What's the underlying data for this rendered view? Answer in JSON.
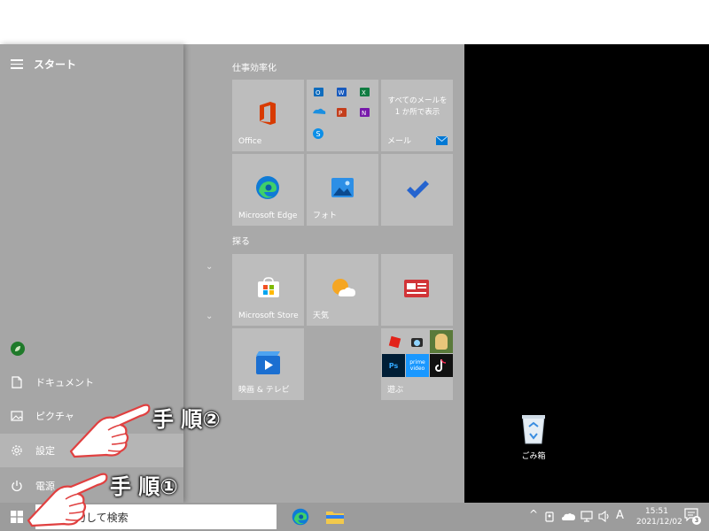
{
  "start_menu": {
    "title": "スタート",
    "rail": [
      {
        "label": "ドキュメント",
        "icon": "document-icon"
      },
      {
        "label": "ピクチャ",
        "icon": "picture-icon"
      },
      {
        "label": "設定",
        "icon": "gear-icon"
      },
      {
        "label": "電源",
        "icon": "power-icon"
      }
    ],
    "groups": {
      "productivity": "仕事効率化",
      "explore": "探る"
    },
    "tiles": {
      "office": "Office",
      "mail_caption": "すべてのメールを 1 か所で表示",
      "mail": "メール",
      "edge": "Microsoft Edge",
      "photos": "フォト",
      "store": "Microsoft Store",
      "weather": "天気",
      "movies": "映画 & テレビ",
      "play": "遊ぶ"
    },
    "small_apps": {
      "prime": "prime video",
      "ps": "Ps"
    }
  },
  "taskbar": {
    "search_placeholder": "入力して検索",
    "clock_time": "15:51",
    "clock_date": "2021/12/02",
    "ime": "A",
    "notification_count": "3"
  },
  "desktop": {
    "recycle_bin": "ごみ箱"
  },
  "annotations": {
    "step2": "手 順②",
    "step1": "手 順①"
  },
  "colors": {
    "office_red": "#d83b01",
    "edge_blue": "#0f7bd6",
    "store_red": "#e74856",
    "weather_orange": "#f5a623",
    "news_red": "#d13438",
    "mail_blue": "#0078d4"
  }
}
